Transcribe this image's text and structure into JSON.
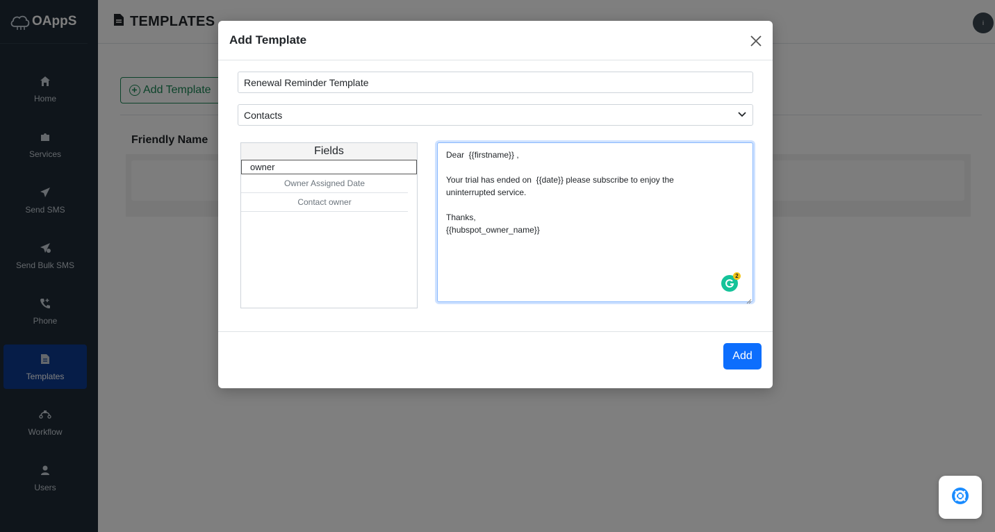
{
  "app": {
    "brand": "OAppS",
    "page_title": "TEMPLATES",
    "user_initial": "i"
  },
  "sidebar": {
    "items": [
      {
        "label": "Home",
        "icon": "home-icon",
        "active": false
      },
      {
        "label": "Services",
        "icon": "puzzle-icon",
        "active": false
      },
      {
        "label": "Send SMS",
        "icon": "paper-plane-icon",
        "active": false
      },
      {
        "label": "Send Bulk SMS",
        "icon": "bulk-send-icon",
        "active": false
      },
      {
        "label": "Phone",
        "icon": "phone-icon",
        "active": false
      },
      {
        "label": "Templates",
        "icon": "document-icon",
        "active": true
      },
      {
        "label": "Workflow",
        "icon": "workflow-icon",
        "active": false
      },
      {
        "label": "Users",
        "icon": "user-icon",
        "active": false
      }
    ]
  },
  "main": {
    "add_template_label": "Add Template",
    "table_header": "Friendly Name"
  },
  "modal": {
    "title": "Add Template",
    "name_value": "Renewal Reminder Template",
    "object_selected": "Contacts",
    "fields_title": "Fields",
    "fields_search_value": "owner",
    "field_items": [
      "Owner Assigned Date",
      "Contact owner"
    ],
    "body_text": "Dear  {{firstname}} ,\n\nYour trial has ended on  {{date}} please subscribe to enjoy the\nuninterrupted service.\n\nThanks,\n{{hubspot_owner_name}}",
    "grammarly_count": "2",
    "add_button": "Add"
  },
  "colors": {
    "sidebar_bg": "#1e2a36",
    "active_nav": "#0d3b91",
    "primary": "#0d6efd",
    "success": "#198754"
  }
}
